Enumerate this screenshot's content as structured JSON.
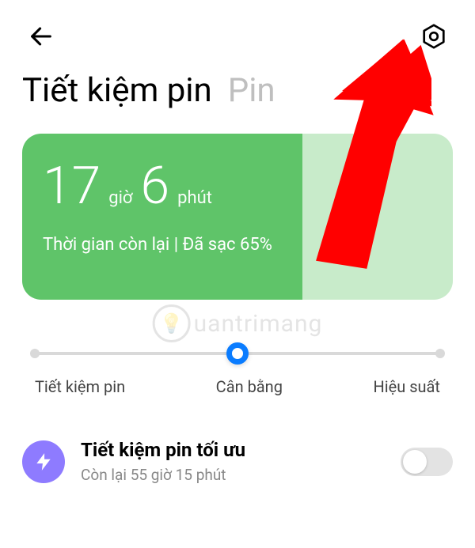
{
  "tabs": {
    "active": "Tiết kiệm pin",
    "inactive": "Pin"
  },
  "battery": {
    "hours": "17",
    "hours_unit": "giờ",
    "minutes": "6",
    "minutes_unit": "phút",
    "status": "Thời gian còn lại | Đã sạc 65%",
    "fill_percent": 65
  },
  "slider": {
    "labels": [
      "Tiết kiệm pin",
      "Cân bằng",
      "Hiệu suất"
    ],
    "selected_index": 1
  },
  "optimal": {
    "title": "Tiết kiệm pin tối ưu",
    "subtitle": "Còn lại 55 giờ 15 phút",
    "enabled": false
  },
  "watermark": "uantrimang",
  "icons": {
    "back": "back-arrow",
    "settings": "gear-hex",
    "bolt": "lightning"
  },
  "colors": {
    "fill": "#5fc469",
    "rest": "#c8ebca",
    "accent": "#0a7cff",
    "opt_icon": "#8e7bff"
  }
}
